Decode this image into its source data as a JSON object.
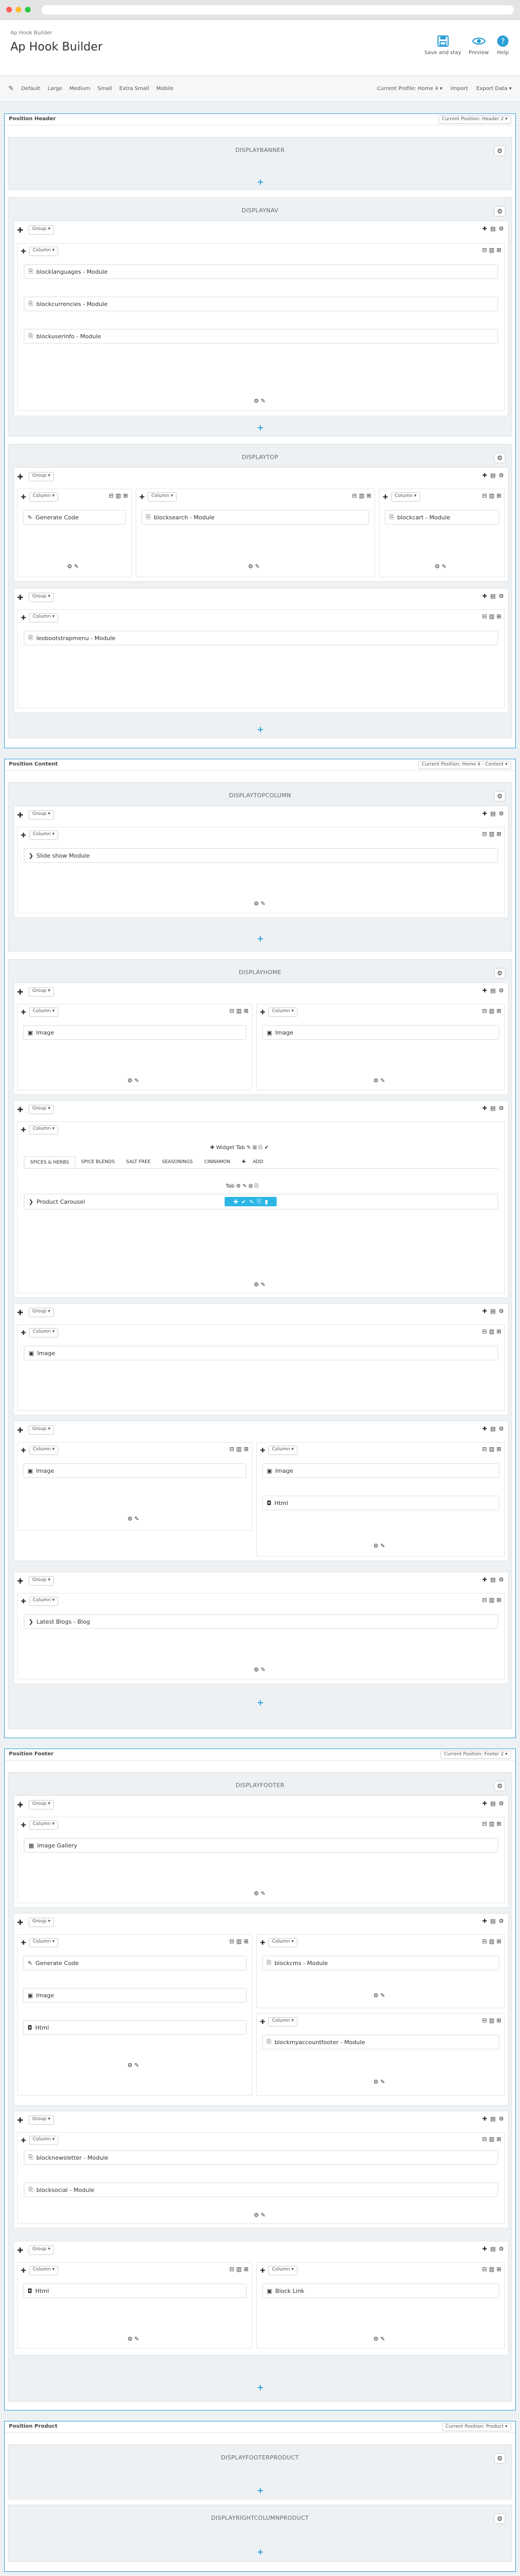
{
  "header": {
    "breadcrumb": "Ap Hook Builder",
    "title": "Ap Hook Builder",
    "save_label": "Save and stay",
    "preview_label": "Preview",
    "help_label": "Help"
  },
  "toolbar": {
    "sizes": [
      "Default",
      "Large",
      "Medium",
      "Small",
      "Extra Small",
      "Mobile"
    ],
    "current_profile": "Current Profile: Home 4 ▾",
    "import": "Import",
    "export": "Export Data ▾"
  },
  "colors": {
    "accent": "#2a9fd6",
    "highlight": "#2bb6e5"
  },
  "labels": {
    "group": "Group ▾",
    "column": "Column ▾",
    "widget_tab": "Widget Tab",
    "tab": "Tab",
    "add": "ADD"
  },
  "positions": {
    "header": {
      "title": "Position Header",
      "current": "Current Position: Header 2 ▾"
    },
    "content": {
      "title": "Position Content",
      "current": "Current Position: Home 4 - Content ▾"
    },
    "footer": {
      "title": "Position Footer",
      "current": "Current Position: Footer 2 ▾"
    },
    "product": {
      "title": "Position Product",
      "current": "Current Position: Product ▾"
    }
  },
  "hooks": {
    "displaybanner": "DISPLAYBANNER",
    "displaynav": "DISPLAYNAV",
    "displaytop": "DISPLAYTOP",
    "displaytopcolumn": "DISPLAYTOPCOLUMN",
    "displayhome": "DISPLAYHOME",
    "displayfooter": "DISPLAYFOOTER",
    "displayfooterproduct": "DISPLAYFOOTERPRODUCT",
    "displayrightcolumnproduct": "DISPLAYRIGHTCOLUMNPRODUCT"
  },
  "modules": {
    "blocklanguages": "blocklanguages - Module",
    "blockcurrencies": "blockcurrencies - Module",
    "blockuserinfo": "blockuserinfo - Module",
    "generate_code": "Generate Code",
    "blocksearch": "blocksearch - Module",
    "blockcart": "blockcart - Module",
    "leobootstrapmenu": "leobootstrapmenu - Module",
    "slideshow": "Slide show Module",
    "image": "Image",
    "html": "Html",
    "product_carousel": "Product Carousel",
    "latest_blogs": "Latest Blogs - Blog",
    "image_gallery": "Image Gallery",
    "blockcms": "blockcms - Module",
    "blockmyaccountfooter": "blockmyaccountfooter - Module",
    "blocknewsletter": "blocknewsletter - Module",
    "blocksocial": "blocksocial - Module",
    "block_link": "Block Link"
  },
  "tabs": [
    "SPICES & HERBS",
    "SPICE BLENDS",
    "SALT FREE",
    "SEASONINGS",
    "CINNAMON"
  ]
}
